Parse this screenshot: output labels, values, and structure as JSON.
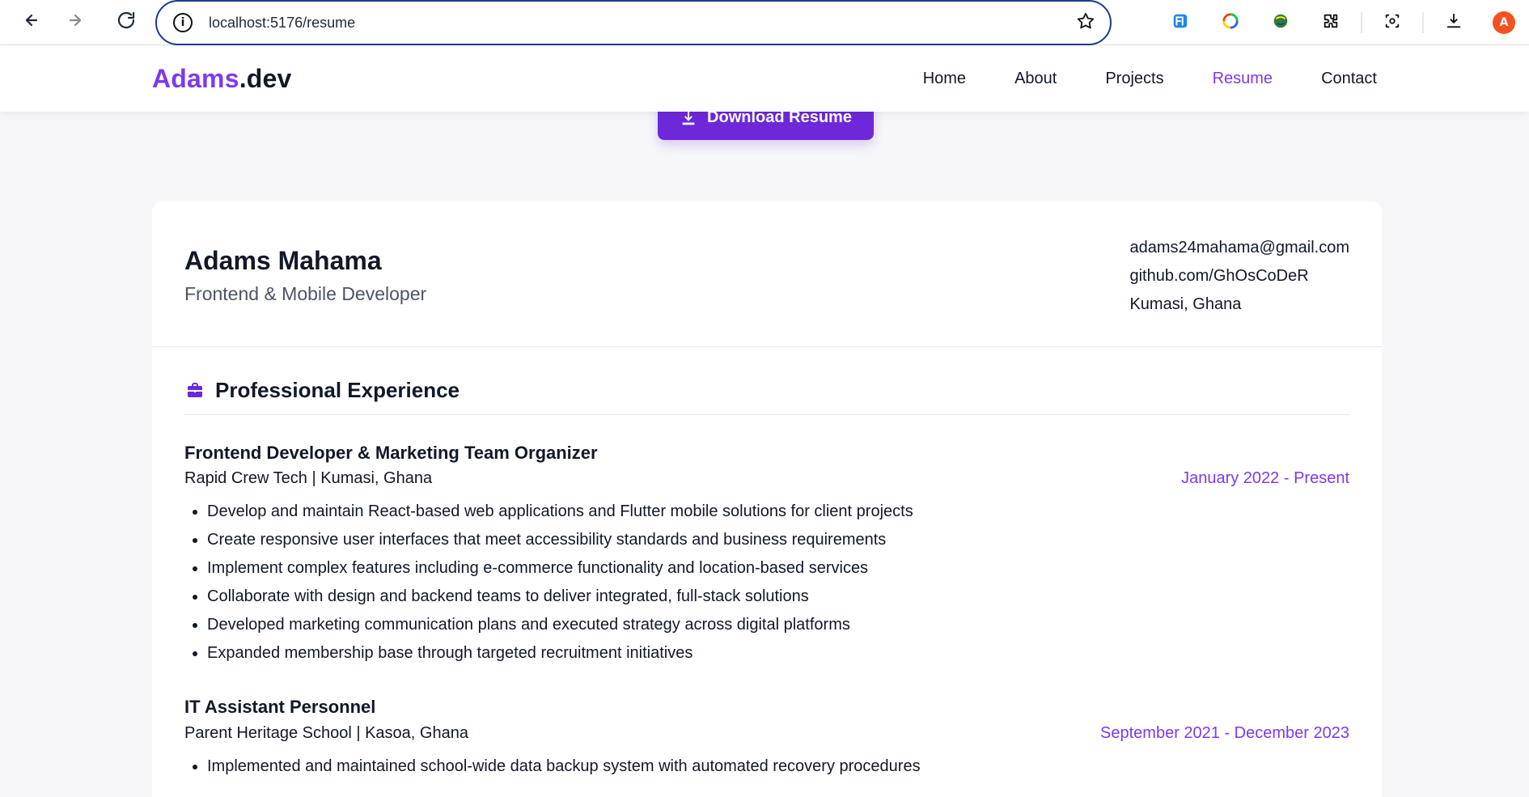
{
  "browser": {
    "url": "localhost:5176/resume",
    "profile_initial": "A",
    "icons": {
      "back": "back-arrow-icon",
      "forward": "forward-arrow-icon",
      "reload": "reload-icon",
      "info": "info-icon",
      "bookmark": "star-icon",
      "ext1": "extension-fi-icon",
      "ext2": "extension-colorwheel-icon",
      "ext3": "extension-globe-icon",
      "extensions": "puzzle-icon",
      "screenshot": "screenshot-icon",
      "downloads": "download-icon"
    }
  },
  "site": {
    "brand_prefix": "Adams",
    "brand_suffix": ".dev",
    "nav": [
      {
        "label": "Home"
      },
      {
        "label": "About"
      },
      {
        "label": "Projects"
      },
      {
        "label": "Resume",
        "active": true
      },
      {
        "label": "Contact"
      }
    ]
  },
  "page": {
    "download_label": "Download Resume"
  },
  "resume": {
    "name": "Adams Mahama",
    "role": "Frontend & Mobile Developer",
    "contact": {
      "email": "adams24mahama@gmail.com",
      "github": "github.com/GhOsCoDeR",
      "location": "Kumasi, Ghana"
    },
    "section_title": "Professional Experience",
    "jobs": [
      {
        "title": "Frontend Developer & Marketing Team Organizer",
        "company": "Rapid Crew Tech | Kumasi, Ghana",
        "dates": "January 2022 - Present",
        "bullets": [
          "Develop and maintain React-based web applications and Flutter mobile solutions for client projects",
          "Create responsive user interfaces that meet accessibility standards and business requirements",
          "Implement complex features including e-commerce functionality and location-based services",
          "Collaborate with design and backend teams to deliver integrated, full-stack solutions",
          "Developed marketing communication plans and executed strategy across digital platforms",
          "Expanded membership base through targeted recruitment initiatives"
        ]
      },
      {
        "title": "IT Assistant Personnel",
        "company": "Parent Heritage School | Kasoa, Ghana",
        "dates": "September 2021 - December 2023",
        "bullets": [
          "Implemented and maintained school-wide data backup system with automated recovery procedures"
        ]
      }
    ]
  },
  "colors": {
    "brand": "#7c3aed",
    "button": "#6d28d9",
    "avatar": "#f4511e"
  }
}
